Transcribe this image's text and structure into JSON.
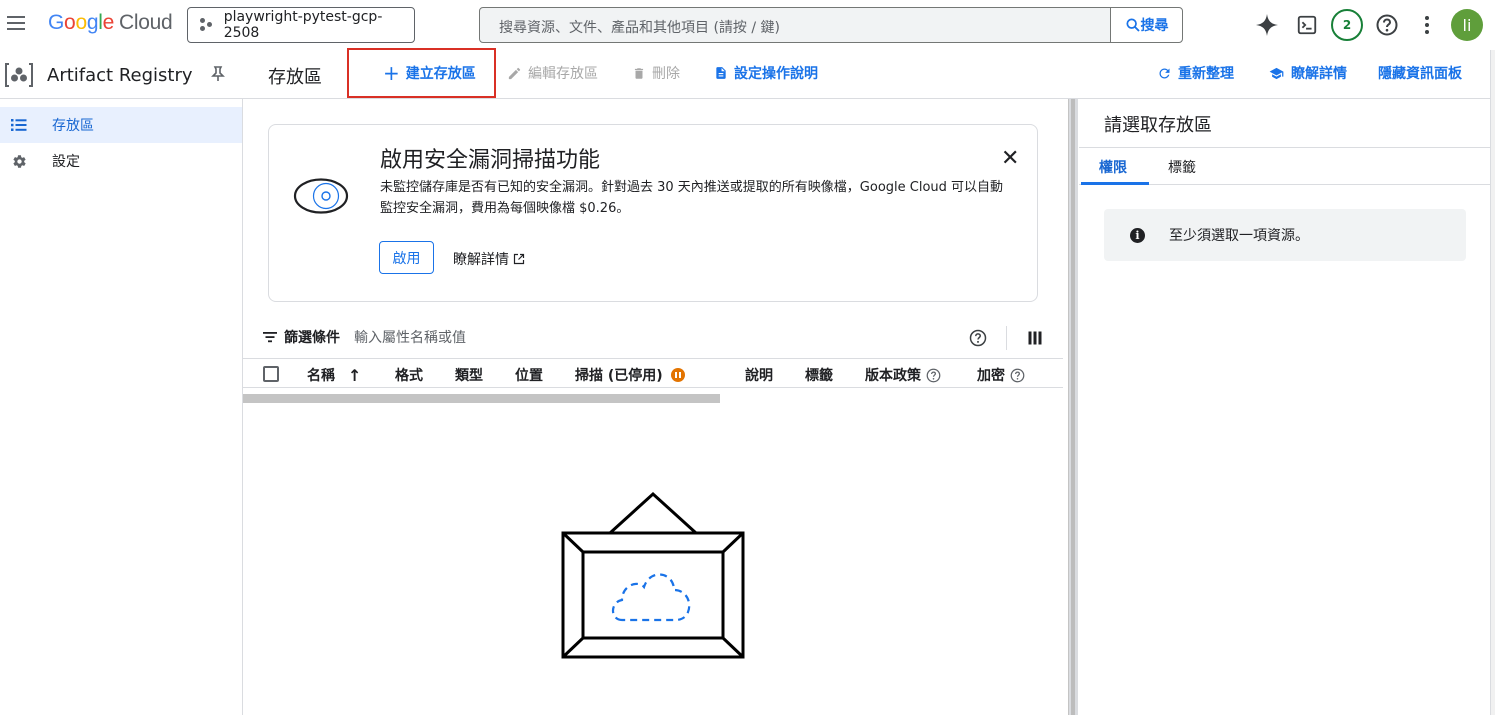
{
  "topbar": {
    "logo_google": "Google",
    "logo_cloud": "Cloud",
    "project": "playwright-pytest-gcp-2508",
    "search_placeholder": "搜尋資源、文件、產品和其他項目 (請按 / 鍵)",
    "search_button": "搜尋",
    "notifications_count": "2",
    "avatar_letter": "li"
  },
  "product": {
    "name": "Artifact Registry"
  },
  "sidebar": {
    "items": [
      {
        "label": "存放區",
        "icon": "list-icon",
        "active": true
      },
      {
        "label": "設定",
        "icon": "gear-icon",
        "active": false
      }
    ]
  },
  "toolbar": {
    "page_title": "存放區",
    "create": "建立存放區",
    "edit": "編輯存放區",
    "delete": "刪除",
    "setup": "設定操作說明",
    "refresh": "重新整理",
    "learn": "瞭解詳情",
    "hide_panel": "隱藏資訊面板"
  },
  "banner": {
    "title": "啟用安全漏洞掃描功能",
    "desc": "未監控儲存庫是否有已知的安全漏洞。針對過去 30 天內推送或提取的所有映像檔，Google Cloud 可以自動監控安全漏洞，費用為每個映像檔 $0.26。",
    "enable": "啟用",
    "learn_more": "瞭解詳情"
  },
  "filter": {
    "label": "篩選條件",
    "placeholder": "輸入屬性名稱或值"
  },
  "table": {
    "columns": [
      "名稱",
      "格式",
      "類型",
      "位置",
      "掃描 (已停用)",
      "說明",
      "標籤",
      "版本政策",
      "加密"
    ]
  },
  "panel": {
    "title": "請選取存放區",
    "tabs": [
      "權限",
      "標籤"
    ],
    "info": "至少須選取一項資源。"
  },
  "colors": {
    "accent": "#1a73e8",
    "highlight": "#d93025",
    "warning": "#e37400"
  }
}
